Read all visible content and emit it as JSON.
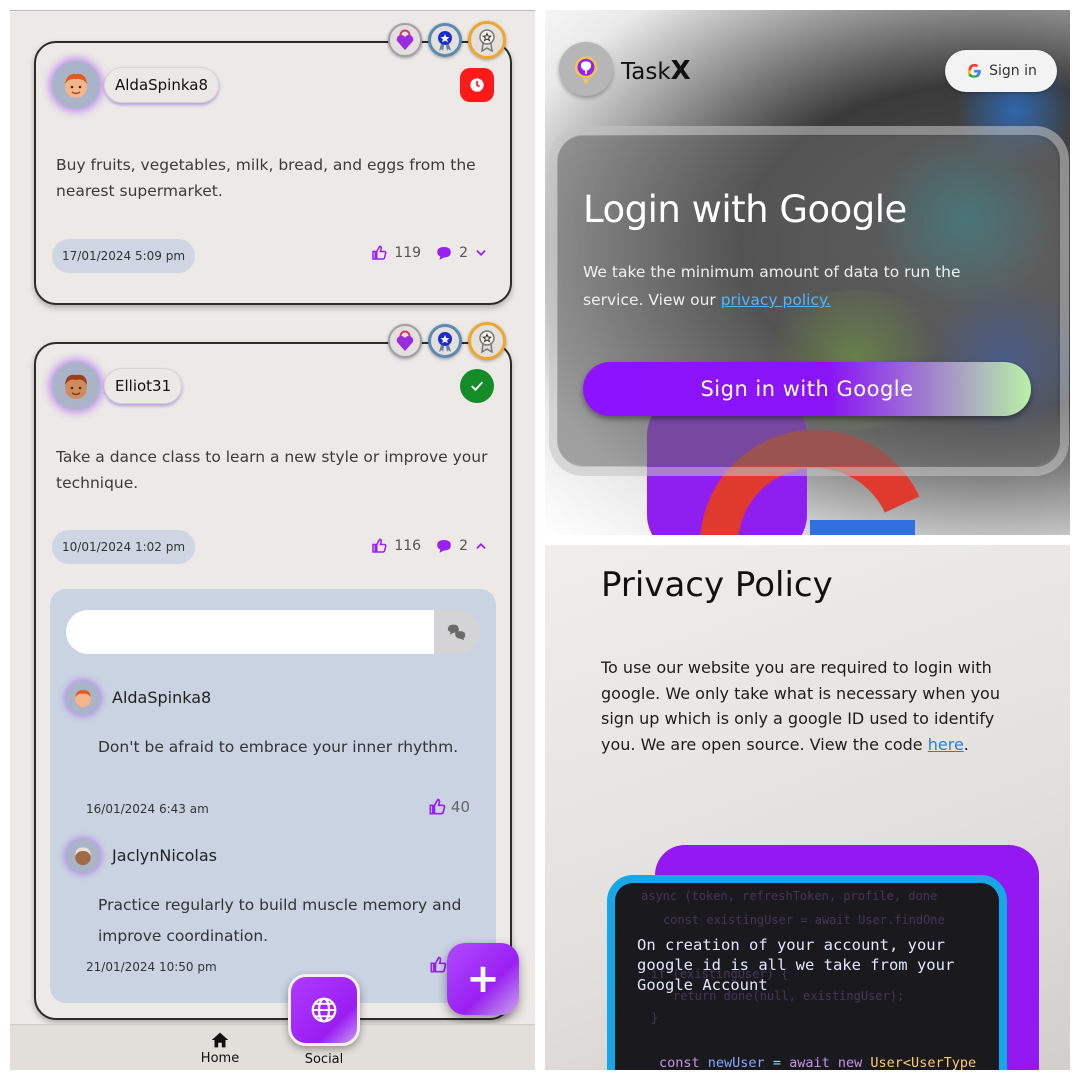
{
  "social": {
    "posts": [
      {
        "username": "AldaSpinka8",
        "text": "Buy fruits, vegetables, milk, bread, and eggs from the nearest supermarket.",
        "date": "17/01/2024 5:09 pm",
        "likes": "119",
        "comments": "2",
        "status": "clock-icon"
      },
      {
        "username": "Elliot31",
        "text": "Take a dance class to learn a new style or improve your technique.",
        "date": "10/01/2024 1:02 pm",
        "likes": "116",
        "comments": "2",
        "status": "check-icon",
        "comment_list": [
          {
            "username": "AldaSpinka8",
            "text": "Don't be afraid to embrace your inner rhythm.",
            "date": "16/01/2024 6:43 am",
            "likes": "40"
          },
          {
            "username": "JaclynNicolas",
            "text": "Practice regularly to build muscle memory and improve coordination.",
            "date": "21/01/2024 10:50 pm",
            "likes": ""
          }
        ]
      }
    ],
    "comment_input": {
      "value": "",
      "placeholder": ""
    },
    "fab_label": "+",
    "nav": {
      "home": "Home",
      "social": "Social"
    },
    "colors": {
      "accent": "#9a20f2",
      "status_red": "#ff1a1a",
      "status_green": "#148c27"
    }
  },
  "login": {
    "brand": {
      "name_prefix": "Task",
      "name_suffix": "X"
    },
    "header_signin": "Sign in",
    "title": "Login with Google",
    "desc_before": "We take the minimum amount of data to run the service. View our ",
    "desc_link": "privacy policy.",
    "button": "Sign in with Google"
  },
  "privacy": {
    "title": "Privacy Policy",
    "text_before": "To use our website you are required to login with google. We only take what is necessary when you sign up which is only a google ID used to identify you. We are open source. View the code ",
    "link": "here",
    "text_after": ".",
    "code_caption": "On creation of your account, your google id is all we take from your Google Account",
    "code_bottom": {
      "kw1": "const",
      "var": "newUser",
      "op": "=",
      "kw2": "await",
      "kw3": "new",
      "cls": "User<UserType"
    },
    "code_bg_lines": [
      "async (token, refreshToken, profile, done",
      "const existingUser = await User.findOne",
      "if (existingUser) {",
      "return done(null, existingUser);",
      "}"
    ]
  }
}
